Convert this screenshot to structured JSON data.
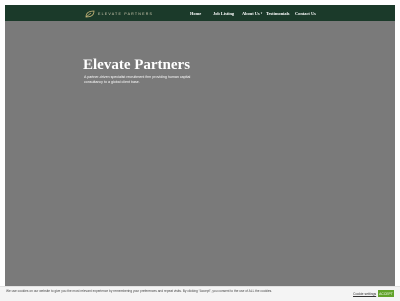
{
  "header": {
    "brand_name": "ELEVATE PARTNERS",
    "logo_icon": "leaf-logo-icon",
    "colors": {
      "navbar": "#1b3a2a",
      "hero_overlay": "#7a7a7a",
      "accept": "#61a229"
    }
  },
  "nav": {
    "items": [
      {
        "label": "Home"
      },
      {
        "label": "Job Listing"
      },
      {
        "label": "About Us"
      },
      {
        "label": "Testimonials"
      },
      {
        "label": "Contact Us"
      }
    ],
    "dropdown_icon": "chevron-down-icon"
  },
  "hero": {
    "title": "Elevate Partners",
    "description": "A partner-driven specialist recruitment firm providing human capital consultancy to a global client base."
  },
  "cookie": {
    "text": "We use cookies on our website to give you the most relevant experience by remembering your preferences and repeat visits. By clicking “Accept”, you consent to the use of ALL the cookies.",
    "settings_label": "Cookie settings",
    "accept_label": "ACCEPT"
  }
}
